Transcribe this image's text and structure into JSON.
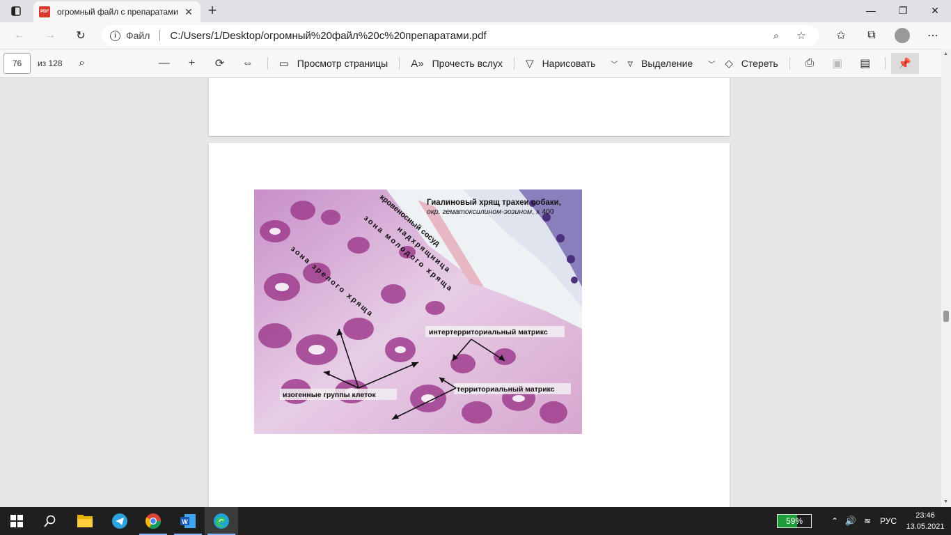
{
  "browser": {
    "tab_title": "огромный файл с препаратами",
    "tab_favicon_text": "PDF",
    "address_scheme_label": "Файл",
    "url": "C:/Users/1/Desktop/огромный%20файл%20с%20препаратами.pdf"
  },
  "pdf_toolbar": {
    "page_current": "76",
    "page_total_label": "из 128",
    "page_view_label": "Просмотр страницы",
    "read_aloud_label": "Прочесть вслух",
    "draw_label": "Нарисовать",
    "highlight_label": "Выделение",
    "erase_label": "Стереть"
  },
  "figure": {
    "title": "Гиалиновый хрящ трахеи собаки,",
    "subtitle": "окр. гематоксилином-эозином",
    "magnification": ", х 400",
    "labels": {
      "vessel": "кровеносный сосуд",
      "perichondrium": "надхрящница",
      "young_zone": "зона молодого хряща",
      "mature_zone": "зона зрелого хряща",
      "interterritorial": "интертерриториальный матрикс",
      "territorial": "территориальный матрикс",
      "isogenic": "изогенные группы клеток"
    }
  },
  "taskbar": {
    "battery_percent": "59%",
    "battery_level": 0.59,
    "language": "РУС",
    "time": "23:46",
    "date": "13.05.2021"
  },
  "icons": {
    "tab_actions": "tab-actions-icon",
    "back": "back-arrow-icon",
    "forward": "forward-arrow-icon",
    "refresh": "refresh-icon",
    "info": "info-icon",
    "zoom": "zoom-icon",
    "favorite_add": "favorite-add-icon",
    "favorites": "favorites-icon",
    "collections": "collections-icon",
    "profile": "profile-avatar",
    "more": "more-menu-icon"
  },
  "colors": {
    "battery_green": "#1e9c3a",
    "taskbar_bg": "#1f1f1f",
    "accent": "#0078d4"
  }
}
